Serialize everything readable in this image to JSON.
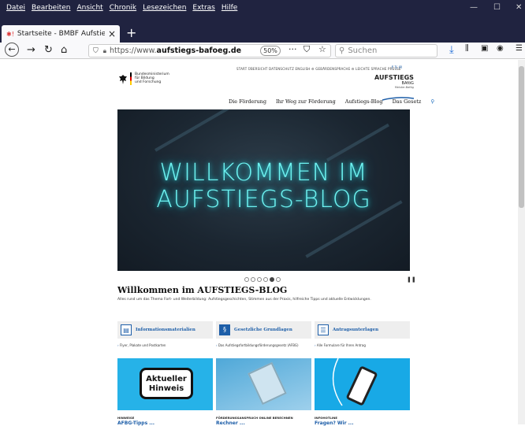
{
  "browser": {
    "menu": [
      "Datei",
      "Bearbeiten",
      "Ansicht",
      "Chronik",
      "Lesezeichen",
      "Extras",
      "Hilfe"
    ],
    "tab_title": "Startseite - BMBF Aufstiegs-BAf",
    "url_prefix": "https://www.",
    "url_domain": "aufstiegs-bafoeg.de",
    "zoom": "50%",
    "search_placeholder": "Suchen"
  },
  "site": {
    "ministry_lines": [
      "Bundesministerium",
      "für Bildung",
      "und Forschung"
    ],
    "top_links": "START  ÜBERSICHT  DATENSCHUTZ  ENGLISH  ⚙ GEBÄRDENSPRACHE  ⚙ LEICHTE SPRACHE  PRESSE",
    "brand_title": "AUFSTIEGS",
    "brand_sub": "BAföG",
    "brand_tag": "Meister-Bafög",
    "nav": [
      "Die Förderung",
      "Ihr Weg zur Förderung",
      "Aufstiegs-Blog",
      "Das Gesetz"
    ],
    "hero_line1": "WILLKOMMEN IM",
    "hero_line2": "AUFSTIEGS-BLOG",
    "carousel": {
      "count": 6,
      "active_index": 4
    },
    "welcome_title": "Willkommen im AUFSTIEGS-BLOG",
    "welcome_sub": "Alles rund um das Thema Fort- und Weiterbildung: Aufstiegsgeschichten, Stimmen aus der Praxis, hilfreiche Tipps und aktuelle Entwicklungen.",
    "cards": [
      {
        "label": "Informationsmaterialien",
        "link": "Flyer, Plakate und Postkarten",
        "icon": "book-icon"
      },
      {
        "label": "Gesetzliche Grundlagen",
        "link": "Das Aufstiegsfortbildungsförderungsgesetz (AFBG)",
        "icon": "paragraph-icon"
      },
      {
        "label": "Antragsunterlagen",
        "link": "Alle Formulare für Ihren Antrag",
        "icon": "document-icon"
      }
    ],
    "tiles": [
      {
        "tag": "HINWEISE",
        "bubble1": "Aktueller",
        "bubble2": "Hinweis",
        "cut": "AFBG-Tipps ..."
      },
      {
        "tag": "FÖRDERUNGSANSPRUCH ONLINE BERECHNEN",
        "cut": "Rechner ..."
      },
      {
        "tag": "INFOHOTLINE",
        "cut": "Fragen? Wir ..."
      }
    ],
    "colors": {
      "brand_blue": "#1d5ea8",
      "neon": "#6df2f0",
      "chrome": "#202340"
    }
  }
}
